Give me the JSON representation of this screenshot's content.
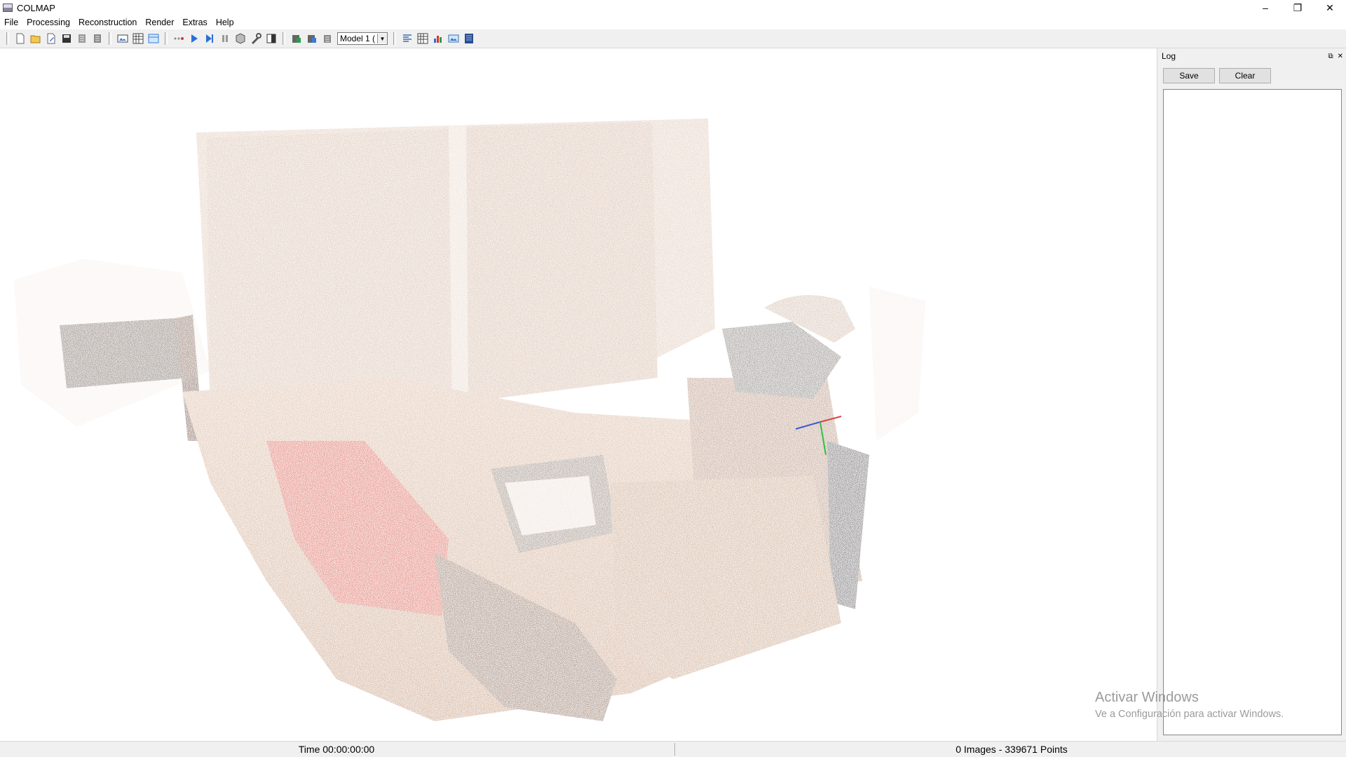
{
  "window": {
    "title": "COLMAP",
    "minimize": "–",
    "restore": "❐",
    "close": "✕"
  },
  "menu": [
    "File",
    "Processing",
    "Reconstruction",
    "Render",
    "Extras",
    "Help"
  ],
  "toolbar": {
    "model_select": "Model 1 (",
    "icons": [
      "new-project",
      "open-project",
      "edit-project",
      "save-project",
      "import-model",
      "export-model",
      "feature-extraction",
      "feature-matching",
      "database-management",
      "automatic-reconstruction",
      "start-reconstruction",
      "step-reconstruction",
      "pause-reconstruction",
      "bundle-adjustment",
      "dense-reconstruction",
      "render-options",
      "reconstruction-stats",
      "match-matrix",
      "log-toggle",
      "model-viewer-grid",
      "rec-stats",
      "match-stats",
      "export-image",
      "logo"
    ]
  },
  "log": {
    "title": "Log",
    "save_label": "Save",
    "clear_label": "Clear",
    "float_icon": "⧉",
    "close_icon": "✕"
  },
  "watermark": {
    "line1": "Activar Windows",
    "line2": "Ve a Configuración para activar Windows."
  },
  "status": {
    "time": "Time 00:00:00:00",
    "counts": "0 Images - 339671 Points"
  },
  "colors": {
    "toolbar_bg": "#f0f0f0",
    "pointcloud_skin": "#d8b29a",
    "pointcloud_dark": "#6b5a50",
    "pillow": "#d9574a"
  }
}
